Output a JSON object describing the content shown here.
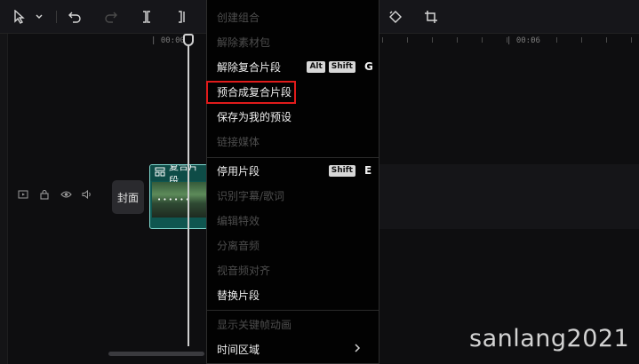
{
  "timeline": {
    "ruler_start": "| 00:00",
    "ruler_mark": "| 00:06",
    "cover_label": "封面",
    "clip_label": "复合片段",
    "clip_thumb_text": "• • • • • •"
  },
  "context_menu": {
    "items": [
      {
        "label": "创建组合",
        "enabled": false
      },
      {
        "label": "解除素材包",
        "enabled": false
      },
      {
        "label": "解除复合片段",
        "enabled": true,
        "keys": [
          "Alt",
          "Shift"
        ],
        "letter": "G"
      },
      {
        "label": "预合成复合片段",
        "enabled": true,
        "highlighted": true
      },
      {
        "label": "保存为我的预设",
        "enabled": true
      },
      {
        "label": "链接媒体",
        "enabled": false
      },
      {
        "label": "停用片段",
        "enabled": true,
        "keys": [
          "Shift"
        ],
        "letter": "E"
      },
      {
        "label": "识别字幕/歌词",
        "enabled": false
      },
      {
        "label": "编辑特效",
        "enabled": false
      },
      {
        "label": "分离音频",
        "enabled": false
      },
      {
        "label": "视音频对齐",
        "enabled": false
      },
      {
        "label": "替换片段",
        "enabled": true
      },
      {
        "label": "显示关键帧动画",
        "enabled": false
      },
      {
        "label": "时间区域",
        "enabled": true,
        "submenu_icon": "chevron-right-icon"
      }
    ]
  },
  "watermark": "sanlang2021",
  "colors": {
    "highlight_border": "#e01b1b",
    "clip_fill": "#0f5650",
    "clip_border": "#7fd8cf",
    "menu_bg": "#020202",
    "disabled_text": "#4d4d4d"
  },
  "icons": {
    "toolbar": [
      "cursor-select-icon",
      "chevron-down-icon",
      "undo-icon",
      "redo-icon",
      "split-icon",
      "split-left-icon",
      "rotate-icon",
      "crop-icon"
    ],
    "track_controls": [
      "video-track-icon",
      "lock-icon",
      "eye-icon",
      "volume-icon"
    ]
  }
}
